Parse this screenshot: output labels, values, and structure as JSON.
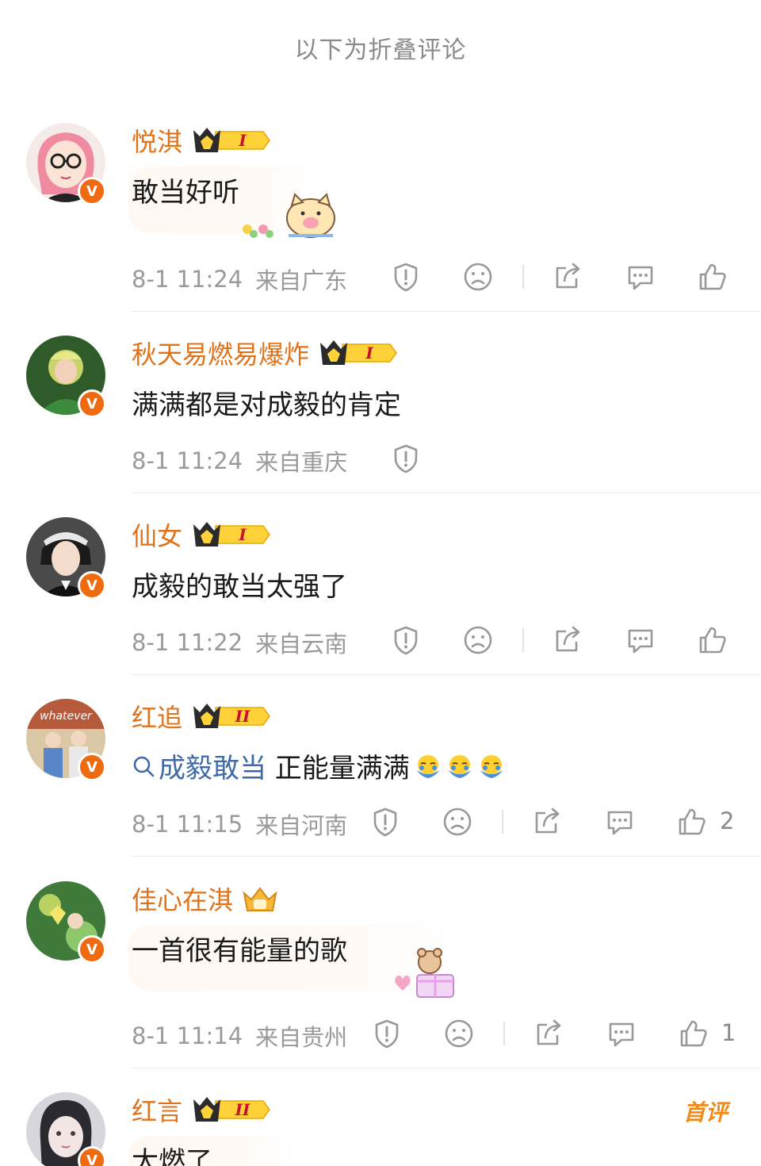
{
  "header": {
    "folded_label": "以下为折叠评论"
  },
  "comments": [
    {
      "username": "悦淇",
      "level": "I",
      "text": "敢当好听",
      "time": "8-1 11:24",
      "location": "来自广东",
      "likes": ""
    },
    {
      "username": "秋天易燃易爆炸",
      "level": "I",
      "text": "满满都是对成毅的肯定",
      "time": "8-1 11:24",
      "location": "来自重庆",
      "likes": ""
    },
    {
      "username": "仙女",
      "level": "I",
      "text": "成毅的敢当太强了",
      "time": "8-1 11:22",
      "location": "来自云南",
      "likes": ""
    },
    {
      "username": "红追",
      "level": "II",
      "topic": "成毅敢当",
      "text": " 正能量满满",
      "time": "8-1 11:15",
      "location": "来自河南",
      "likes": "2"
    },
    {
      "username": "佳心在淇",
      "level": "",
      "text": "一首很有能量的歌",
      "time": "8-1 11:14",
      "location": "来自贵州",
      "likes": "1"
    },
    {
      "username": "红言",
      "level": "II",
      "text": "太燃了",
      "tag": "首评"
    }
  ],
  "colors": {
    "username": "#e0721a",
    "topic": "#3e6aa8",
    "badge": "#f06a0f",
    "meta": "#9a9a9a"
  },
  "icons": [
    "report-icon",
    "dislike-icon",
    "share-icon",
    "reply-icon",
    "like-icon",
    "search-icon",
    "verified-icon",
    "crown-icon"
  ]
}
